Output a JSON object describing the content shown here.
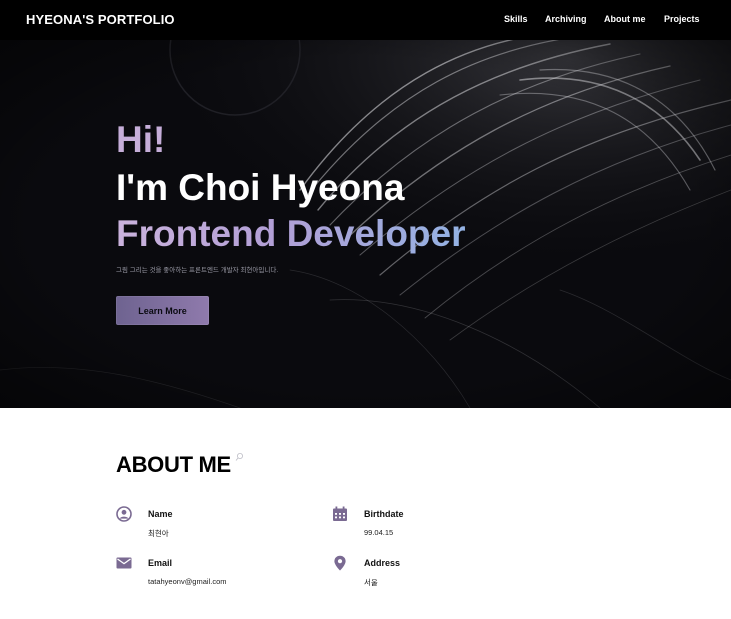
{
  "brand": "HYEONA'S PORTFOLIO",
  "nav": {
    "items": [
      "Skills",
      "Archiving",
      "About me",
      "Projects"
    ]
  },
  "hero": {
    "line1": "Hi!",
    "line2": "I'm Choi Hyeona",
    "line3": "Frontend Developer",
    "subtitle": "그림 그리는 것을 좋아하는 프론트엔드 개발자 최현아입니다.",
    "button": "Learn More"
  },
  "about": {
    "title": "ABOUT ME",
    "icon_color": "#7a6a92",
    "items": [
      {
        "icon": "user-icon",
        "label": "Name",
        "value": "최현아"
      },
      {
        "icon": "calendar-icon",
        "label": "Birthdate",
        "value": "99.04.15"
      },
      {
        "icon": "mail-icon",
        "label": "Email",
        "value": "tatahyeonv@gmail.com"
      },
      {
        "icon": "location-pin-icon",
        "label": "Address",
        "value": "서울"
      }
    ]
  }
}
